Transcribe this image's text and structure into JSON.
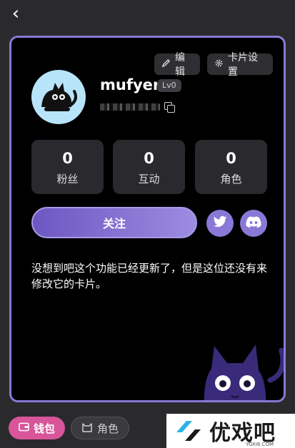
{
  "nav": {
    "back_icon": "chevron-left-icon"
  },
  "header_buttons": {
    "edit_label": "编辑",
    "card_settings_label": "卡片设置"
  },
  "profile": {
    "name": "mufyer",
    "level": "Lv0"
  },
  "stats": [
    {
      "value": "0",
      "label": "粉丝"
    },
    {
      "value": "0",
      "label": "互动"
    },
    {
      "value": "0",
      "label": "角色"
    }
  ],
  "actions": {
    "follow_label": "关注",
    "social_icons": [
      "twitter-icon",
      "discord-icon"
    ]
  },
  "bio": "没想到吧这个功能已经更新了，但是这位还没有来修改它的卡片。",
  "bottom_tabs": [
    {
      "label": "钱包",
      "icon": "wallet-icon",
      "active": true
    },
    {
      "label": "角色",
      "icon": "cat-face-icon",
      "active": false
    }
  ],
  "watermark": {
    "text": "优戏吧",
    "sub": "YOXI8.COM"
  },
  "colors": {
    "accent": "#8a78d6",
    "active_tab": "#d8559a",
    "card_bg": "#000000",
    "page_bg": "#2a2a2d"
  }
}
